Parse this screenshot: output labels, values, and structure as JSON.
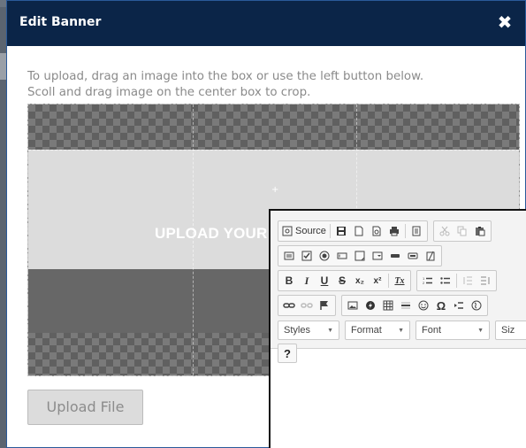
{
  "modal": {
    "title": "Edit Banner",
    "close_glyph": "✖",
    "instructions": [
      "To upload, drag an image into the box or use the left button below.",
      "Scoll and drag image on the center box to crop."
    ],
    "crop_label": "UPLOAD YOUR",
    "crop_center_glyph": "+",
    "upload_button": "Upload File"
  },
  "editor": {
    "source_label": "Source",
    "row1": [
      "save-icon",
      "new-page-icon",
      "preview-icon",
      "print-icon",
      "templates-icon",
      "cut-icon",
      "copy-icon",
      "paste-icon"
    ],
    "row2": [
      "form-icon",
      "checkbox-icon",
      "radio-icon",
      "textfield-icon",
      "textarea-icon",
      "select-icon",
      "button-icon",
      "imagebutton-icon",
      "hiddenfield-icon"
    ],
    "row3": {
      "bold": "B",
      "italic": "I",
      "underline": "U",
      "strike": "S",
      "subscript": "x₂",
      "superscript": "x²",
      "removeformat": "Tx"
    },
    "combos": {
      "styles": "Styles",
      "format": "Format",
      "font": "Font",
      "size": "Siz"
    },
    "help": "?"
  },
  "colors": {
    "header": "#0b2548",
    "accent": "#2a5a9a"
  }
}
